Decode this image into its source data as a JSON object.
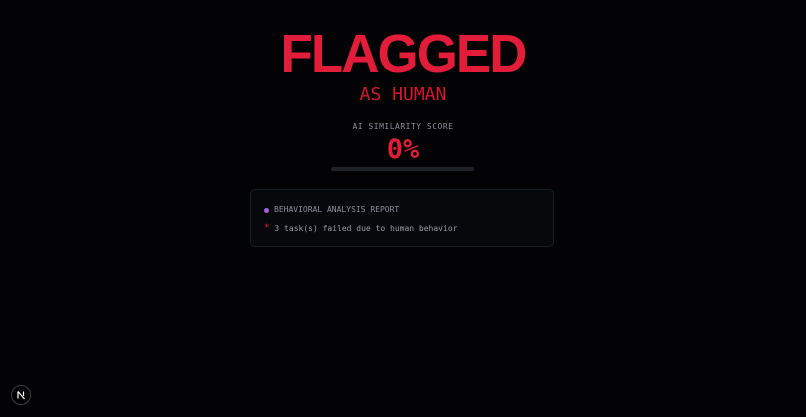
{
  "result": {
    "headline": "FLAGGED",
    "subheadline": "AS HUMAN"
  },
  "score": {
    "label": "AI SIMILARITY SCORE",
    "value": "0%",
    "fill_fraction": 0
  },
  "report": {
    "title": "BEHAVIORAL ANALYSIS REPORT",
    "items": [
      {
        "bullet": "*",
        "text": "3 task(s) failed due to human behavior"
      }
    ]
  },
  "colors": {
    "accent_red": "#e11d3a",
    "status_dot": "#a560e0",
    "background": "#030305"
  },
  "icons": {
    "corner_badge": "nextjs-logo-icon"
  }
}
